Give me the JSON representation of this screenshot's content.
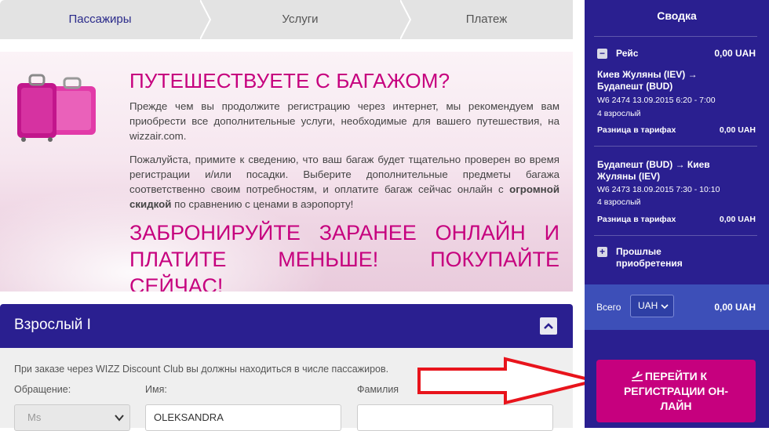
{
  "steps": {
    "passengers": "Пассажиры",
    "services": "Услуги",
    "payment": "Платеж"
  },
  "banner": {
    "title": "ПУТЕШЕСТВУЕТЕ С БАГАЖОМ?",
    "paragraph1": "Прежде чем вы продолжите регистрацию через интернет, мы рекомендуем вам приобрести все дополнительные услуги, необходимые для вашего путешествия, на wizzair.com.",
    "paragraph2_start": "Пожалуйста, примите к сведению, что ваш багаж будет тщательно проверен во время регистрации и/или посадки. Выберите дополнительные предметы багажа соответственно своим потребностям, и оплатите багаж сейчас онлайн с ",
    "paragraph2_bold": "огромной скидкой",
    "paragraph2_end": " по сравнению с ценами в аэропорту!",
    "promo": "ЗАБРОНИРУЙТЕ ЗАРАНЕЕ ОНЛАЙН И ПЛАТИТЕ МЕНЬШЕ! ПОКУПАЙТЕ СЕЙЧАС!"
  },
  "passenger_panel": {
    "title": "Взрослый I",
    "note": "При заказе через WIZZ Discount Club вы должны находиться в числе пассажиров.",
    "salutation_label": "Обращение:",
    "salutation_value": "Ms",
    "first_name_label": "Имя:",
    "first_name_value": "OLEKSANDRA",
    "last_name_label": "Фамилия",
    "last_name_value": ""
  },
  "summary": {
    "title": "Сводка",
    "flight_label": "Рейс",
    "flight_price": "0,00 UAH",
    "leg1": {
      "route": "Киев Жуляны (IEV) → Будапешт (BUD)",
      "details": "W6 2474  13.09.2015 6:20 - 7:00",
      "pax": "4 взрослый",
      "fare_diff_label": "Разница в тарифах",
      "fare_diff_value": "0,00 UAH"
    },
    "leg2": {
      "route": "Будапешт (BUD) → Киев Жуляны (IEV)",
      "details": "W6 2473  18.09.2015 7:30 - 10:10",
      "pax": "4 взрослый",
      "fare_diff_label": "Разница в тарифах",
      "fare_diff_value": "0,00 UAH"
    },
    "past_purchases": "Прошлые приобретения",
    "total_label": "Всего",
    "currency": "UAH",
    "total_value": "0,00 UAH",
    "checkin_button": "ПЕРЕЙТИ К РЕГИСТРАЦИИ ОН-ЛАЙН"
  },
  "colors": {
    "brand_purple": "#2a1f90",
    "brand_magenta": "#c6007e",
    "arrow_red": "#e8141c"
  },
  "icons": {
    "plane": "plane-icon",
    "arrow": "red-arrow-annotation"
  }
}
